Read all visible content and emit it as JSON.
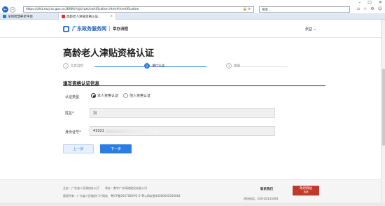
{
  "browser": {
    "address": "https://zhjt.mzj.sz.gov.cn:8080/rlyjt/rzxt/certification.html#/certification",
    "search_placeholder": "搜索...",
    "tabs": [
      {
        "label": "深圳智慧养老平台",
        "active": false
      },
      {
        "label": "高龄老人津贴资格认证...",
        "active": true
      }
    ],
    "window_controls": [
      "–",
      "□",
      "✕"
    ],
    "toolbar_icons": [
      "home-icon",
      "star-icon",
      "gear-icon",
      "smile-icon"
    ]
  },
  "header": {
    "brand": "广东政务服务网",
    "subtitle": "幸办流程",
    "user": "张益"
  },
  "page": {
    "title": "高龄老人津贴资格认证",
    "steps": [
      {
        "num": "✓",
        "label": "信息自检",
        "state": "done"
      },
      {
        "num": "2",
        "label": "进行认证",
        "state": "active"
      },
      {
        "num": "3",
        "label": "完成",
        "state": "todo"
      }
    ],
    "section_title": "填写资格认证信息",
    "form": {
      "type_label": "认证类型",
      "options": [
        {
          "label": "本人资格认证",
          "checked": true
        },
        {
          "label": "他人资格认证",
          "checked": false
        }
      ],
      "name_label": "姓名*",
      "name_value": "刘",
      "id_label": "身份证号*",
      "id_value": "41021"
    },
    "prev_button": "上一步",
    "next_button": "下一步"
  },
  "footer": {
    "line1": "主办：广东省人民政府办公厅　　承办：数字广东网络建设有限公司",
    "line2": "版权所有：广东省人民政府门户网站　粤ICP备05070829号-2 粤公网安备44000002000064",
    "contact": "联系我们",
    "hotline": "热线电话：020-83133494",
    "badge_main": "政府网站",
    "badge_sub": "找错"
  }
}
